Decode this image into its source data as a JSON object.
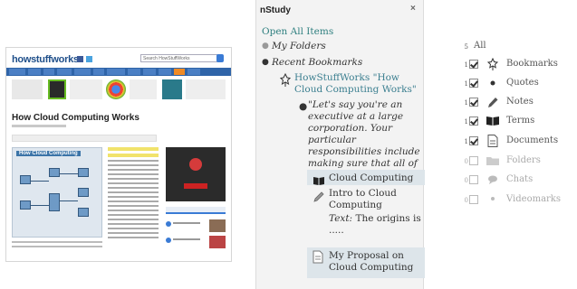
{
  "thumbnail": {
    "logo_text": "howstuffworks",
    "search_placeholder": "Search HowStuffWorks",
    "article_title": "How Cloud Computing Works",
    "figure_caption": "How Cloud Computing"
  },
  "panel": {
    "title": "nStudy",
    "close_label": "×",
    "open_all": "Open All Items",
    "my_folders": "My Folders",
    "recent_bookmarks": "Recent Bookmarks",
    "bookmark_title": "HowStuffWorks \"How Cloud Computing Works\"",
    "quote_text": "\"Let's say you're an executive at a large corporation. Your particular responsibilities include making sure that all of your e\"",
    "term_label": "Cloud Computing",
    "note_title": "Intro to Cloud Computing",
    "note_text_label": "Text:",
    "note_text_value": "The origins is .....",
    "document_title": "My Proposal on Cloud Computing"
  },
  "categories": {
    "all_count": "5",
    "all_label": "All",
    "items": [
      {
        "count": "1",
        "checked": true,
        "icon": "bookmark-icon",
        "label": "Bookmarks"
      },
      {
        "count": "1",
        "checked": true,
        "icon": "quote-icon",
        "label": "Quotes"
      },
      {
        "count": "1",
        "checked": true,
        "icon": "pencil-icon",
        "label": "Notes"
      },
      {
        "count": "1",
        "checked": true,
        "icon": "book-icon",
        "label": "Terms"
      },
      {
        "count": "1",
        "checked": true,
        "icon": "document-icon",
        "label": "Documents"
      },
      {
        "count": "0",
        "checked": false,
        "icon": "folder-icon",
        "label": "Folders"
      },
      {
        "count": "0",
        "checked": false,
        "icon": "chat-icon",
        "label": "Chats"
      },
      {
        "count": "0",
        "checked": false,
        "icon": "video-icon",
        "label": "Videomarks"
      }
    ]
  }
}
